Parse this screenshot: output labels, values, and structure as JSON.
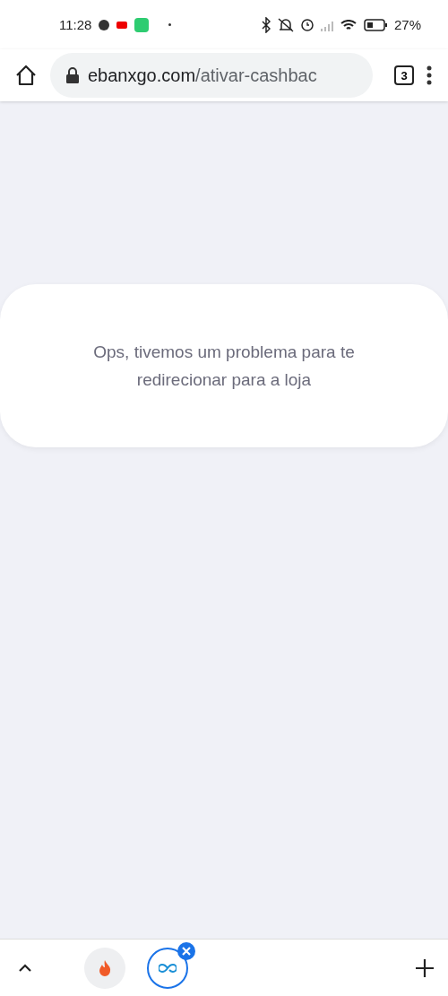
{
  "status_bar": {
    "time": "11:28",
    "battery": "27%"
  },
  "toolbar": {
    "url_domain": "ebanxgo.com",
    "url_path": "/ativar-cashbac",
    "tab_count": "3"
  },
  "card": {
    "message": "Ops, tivemos um problema para te redirecionar para a loja"
  },
  "tab_groups": [
    {
      "kind": "flame",
      "selected": false
    },
    {
      "kind": "link",
      "selected": true
    }
  ]
}
